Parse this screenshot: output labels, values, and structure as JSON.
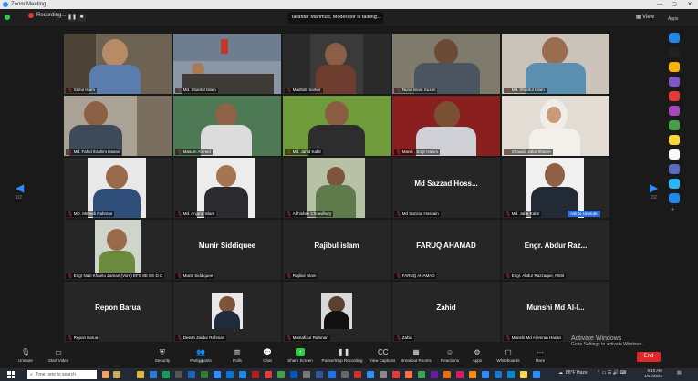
{
  "window": {
    "title": "Zoom Meeting",
    "minimize": "—",
    "maximize": "▢",
    "close": "✕"
  },
  "topbar": {
    "recording": "Recording...",
    "talking": "Tarafdar Mahmud, Moderator is talking...",
    "view": "View"
  },
  "grid": {
    "page_left": "1/2",
    "page_right": "2/2",
    "tiles": [
      {
        "name": "Saiful Islam",
        "text": "",
        "video": true
      },
      {
        "name": "Md. Shariful Islam",
        "text": "",
        "video": true
      },
      {
        "name": "Madhab Sarker",
        "text": "",
        "video": true
      },
      {
        "name": "Nurul Islam Suzon",
        "text": "",
        "video": true
      },
      {
        "name": "Md. Shariful Islam",
        "text": "",
        "video": true
      },
      {
        "name": "Md. Fahid Ibrahim Hasan",
        "text": "",
        "video": true
      },
      {
        "name": "Masum Ahmed",
        "text": "",
        "video": true
      },
      {
        "name": "Md. Jahid Kabir",
        "text": "",
        "video": true
      },
      {
        "name": "Manik , Engr Hakim",
        "text": "",
        "video": true
      },
      {
        "name": "Shawda Jafar Shame",
        "text": "",
        "video": true
      },
      {
        "name": "MD. Mehedi Rahman",
        "text": "",
        "video": true
      },
      {
        "name": "Md. Anjurul Islam",
        "text": "",
        "video": true
      },
      {
        "name": "Abhishek Chowdhury",
        "text": "",
        "video": true
      },
      {
        "name": "Md Sazzad Hossain",
        "text": "Md Sazzad Hoss...",
        "video": false
      },
      {
        "name": "Md. Jafar Kabir",
        "text": "",
        "video": true
      },
      {
        "name": "Engr Nazi Khanto Zaman (Vore) EFS SE BE D.C",
        "text": "",
        "video": true
      },
      {
        "name": "Munir Siddiquee",
        "text": "Munir Siddiquee",
        "video": false
      },
      {
        "name": "Rajibul Islam",
        "text": "Rajibul islam",
        "video": false
      },
      {
        "name": "FARUQ AHAMAD",
        "text": "FARUQ AHAMAD",
        "video": false
      },
      {
        "name": "Engr. Abdur Razzaque, FIEB",
        "text": "Engr. Abdur Raz...",
        "video": false
      },
      {
        "name": "Repon Barua",
        "text": "Repon Barua",
        "video": false
      },
      {
        "name": "Deean Zaidur Rahman",
        "text": "",
        "video": true
      },
      {
        "name": "Mostafizur Rahman",
        "text": "",
        "video": true
      },
      {
        "name": "Zahid",
        "text": "Zahid",
        "video": false
      },
      {
        "name": "Munshi Md Al-Imran Hasan",
        "text": "Munshi Md Al-I...",
        "video": false
      }
    ],
    "badge": "Ask to Unmute"
  },
  "toolbar": {
    "items": [
      {
        "label": "Unmute",
        "icon": "mic-icon"
      },
      {
        "label": "Start Video",
        "icon": "video-icon"
      },
      {
        "label": "Security",
        "icon": "shield-icon"
      },
      {
        "label": "Participants",
        "icon": "participants-icon",
        "count": "27"
      },
      {
        "label": "Polls",
        "icon": "polls-icon"
      },
      {
        "label": "Chat",
        "icon": "chat-icon"
      },
      {
        "label": "Share Screen",
        "icon": "share-icon"
      },
      {
        "label": "Pause/Stop Recording",
        "icon": "record-icon"
      },
      {
        "label": "View Captions",
        "icon": "captions-icon"
      },
      {
        "label": "Breakout Rooms",
        "icon": "breakout-icon"
      },
      {
        "label": "Reactions",
        "icon": "reactions-icon"
      },
      {
        "label": "Apps",
        "icon": "apps-icon"
      },
      {
        "label": "Whiteboards",
        "icon": "whiteboard-icon"
      },
      {
        "label": "More",
        "icon": "more-icon"
      }
    ],
    "end": "End"
  },
  "activate": {
    "line1": "Activate Windows",
    "line2": "Go to Settings to activate Windows."
  },
  "sidebar": {
    "label": "Apps"
  },
  "taskbar": {
    "search": "Type here to search",
    "weather": "88°F Haze",
    "time": "9:10 AM",
    "date": "4/14/2023"
  },
  "colors": {
    "accent": "#2d8cff",
    "end": "#e02828",
    "muted": "#e53935",
    "bg": "#1a1a1a"
  }
}
